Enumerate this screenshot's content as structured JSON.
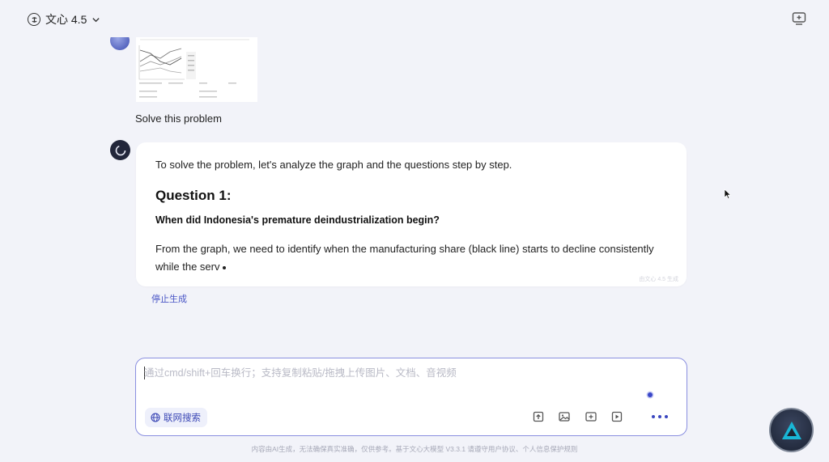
{
  "header": {
    "model_name": "文心 4.5"
  },
  "conversation": {
    "user_message": "Solve this problem",
    "assistant": {
      "intro": "To solve the problem, let's analyze the graph and the questions step by step.",
      "heading": "Question 1:",
      "question": "When did Indonesia's premature deindustrialization begin?",
      "body": "From the graph, we need to identify when the manufacturing share (black line) starts to decline consistently while the serv",
      "watermark": "由文心 4.5 生成"
    },
    "stop_label": "停止生成"
  },
  "composer": {
    "placeholder": "通过cmd/shift+回车换行；支持复制粘贴/拖拽上传图片、文档、音视频",
    "value": "",
    "web_search_label": "联网搜索",
    "tools": [
      "upload-file-icon",
      "image-icon",
      "screenshot-icon",
      "video-icon",
      "more-icon"
    ]
  },
  "footer": {
    "disclaimer": "内容由AI生成，无法确保真实准确，仅供参考。基于文心大模型 V3.3.1 请遵守用户协议、个人信息保护规则"
  },
  "colors": {
    "accent": "#4a56c6",
    "background": "#f2f3f9",
    "input_border": "#8a8fe0"
  }
}
